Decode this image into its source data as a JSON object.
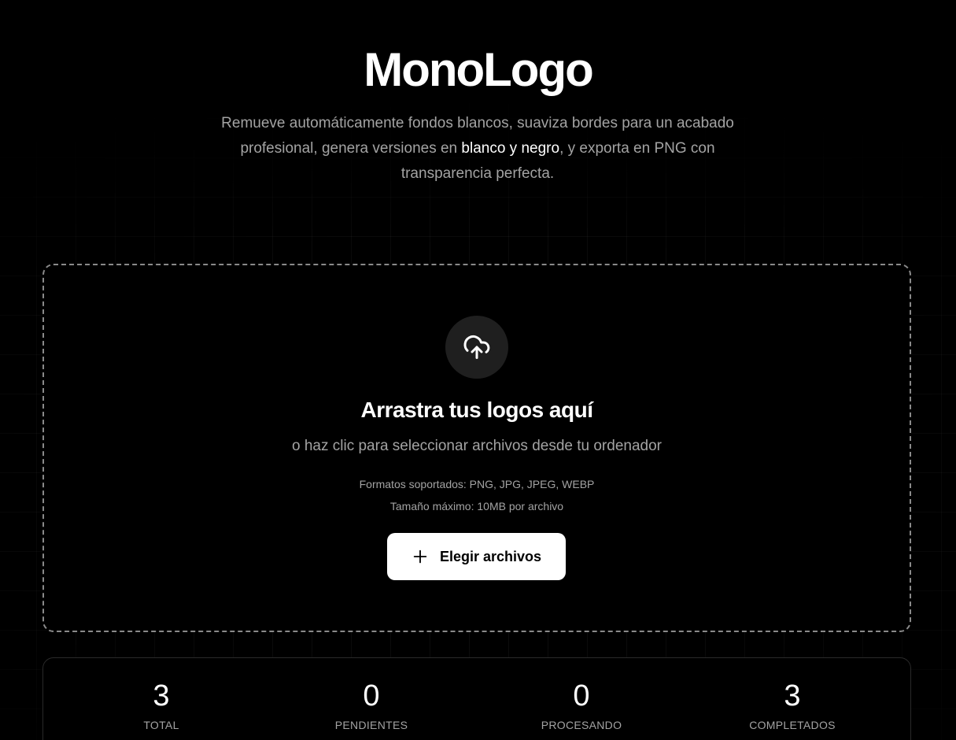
{
  "header": {
    "title": "MonoLogo",
    "subtitle_part1": "Remueve automáticamente fondos blancos, suaviza bordes para un acabado profesional, genera versiones en ",
    "subtitle_highlight": "blanco y negro",
    "subtitle_part2": ", y exporta en PNG con transparencia perfecta."
  },
  "dropzone": {
    "icon": "cloud-upload-icon",
    "title": "Arrastra tus logos aquí",
    "subtitle": "o haz clic para seleccionar archivos desde tu ordenador",
    "formats": "Formatos soportados: PNG, JPG, JPEG, WEBP",
    "max_size": "Tamaño máximo: 10MB por archivo",
    "button_icon": "plus-icon",
    "button_label": "Elegir archivos"
  },
  "stats": [
    {
      "value": "3",
      "label": "TOTAL"
    },
    {
      "value": "0",
      "label": "PENDIENTES"
    },
    {
      "value": "0",
      "label": "PROCESANDO"
    },
    {
      "value": "3",
      "label": "COMPLETADOS"
    }
  ],
  "colors": {
    "background": "#000000",
    "muted_text": "#a3a3a3",
    "upload_circle": "#1f1f1f",
    "dashed_border": "#8a8a8a",
    "button_bg": "#ffffff"
  }
}
